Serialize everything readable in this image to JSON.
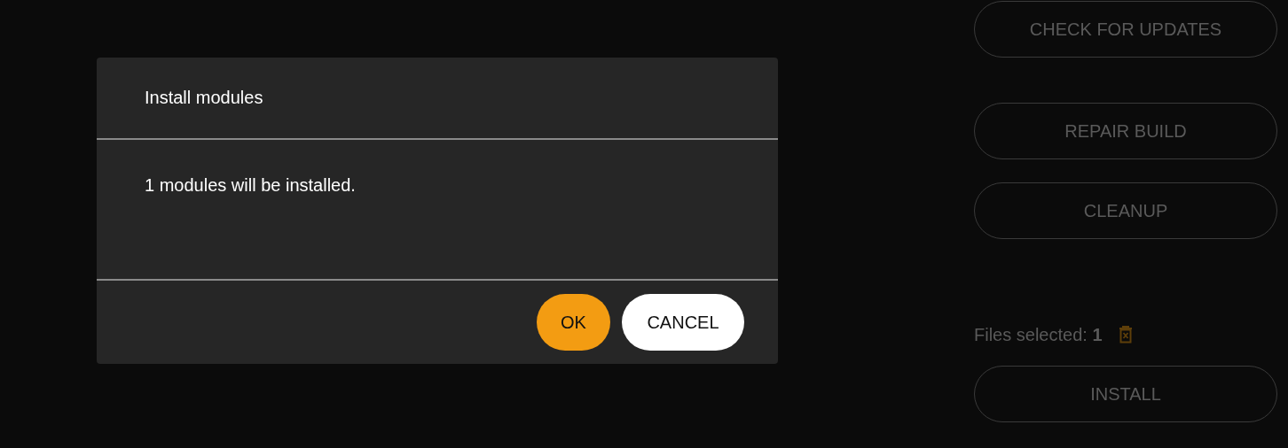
{
  "side_buttons": [
    {
      "label": "CHECK FOR UPDATES"
    },
    {
      "label": "REPAIR BUILD"
    },
    {
      "label": "CLEANUP"
    }
  ],
  "files": {
    "label": "Files selected:",
    "count": "1"
  },
  "install_button": {
    "label": "INSTALL"
  },
  "dialog": {
    "title": "Install modules",
    "message": "1 modules will be installed.",
    "buttons": [
      {
        "label": "OK",
        "kind": "primary"
      },
      {
        "label": "CANCEL",
        "kind": "secondary"
      }
    ]
  }
}
